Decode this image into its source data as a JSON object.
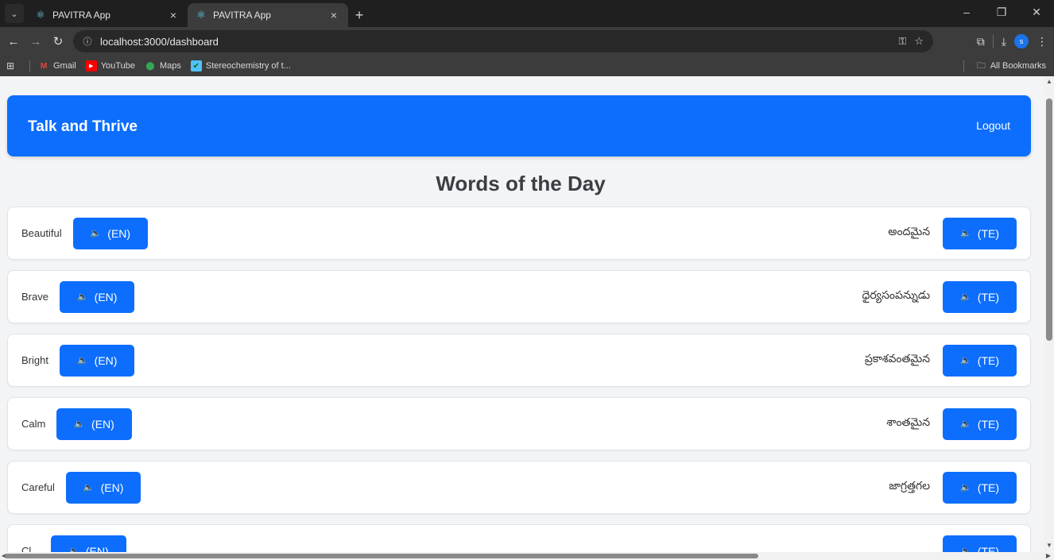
{
  "browser": {
    "tabs": [
      {
        "title": "PAVITRA App",
        "close": "×"
      },
      {
        "title": "PAVITRA App",
        "close": "×"
      }
    ],
    "new_tab": "+",
    "url": "localhost:3000/dashboard",
    "bookmarks": [
      {
        "label": "Gmail",
        "icon": "gmail-icon"
      },
      {
        "label": "YouTube",
        "icon": "youtube-icon"
      },
      {
        "label": "Maps",
        "icon": "maps-icon"
      },
      {
        "label": "Stereochemistry of t...",
        "icon": "checkbox-icon"
      }
    ],
    "all_bookmarks": "All Bookmarks",
    "profile_initial": "s"
  },
  "app": {
    "title": "Talk and Thrive",
    "logout": "Logout",
    "accent_color": "#0d6efd"
  },
  "section_title": "Words of the Day",
  "words": [
    {
      "en": "Beautiful",
      "te": "అందమైన",
      "en_btn": "(EN)",
      "te_btn": "(TE)"
    },
    {
      "en": "Brave",
      "te": "ధైర్యసంపన్నుడు",
      "en_btn": "(EN)",
      "te_btn": "(TE)"
    },
    {
      "en": "Bright",
      "te": "ప్రకాశవంతమైన",
      "en_btn": "(EN)",
      "te_btn": "(TE)"
    },
    {
      "en": "Calm",
      "te": "శాంతమైన",
      "en_btn": "(EN)",
      "te_btn": "(TE)"
    },
    {
      "en": "Careful",
      "te": "జాగ్రత్తగల",
      "en_btn": "(EN)",
      "te_btn": "(TE)"
    },
    {
      "en": "Cl...",
      "te": "...",
      "en_btn": "(EN)",
      "te_btn": "(TE)"
    }
  ]
}
